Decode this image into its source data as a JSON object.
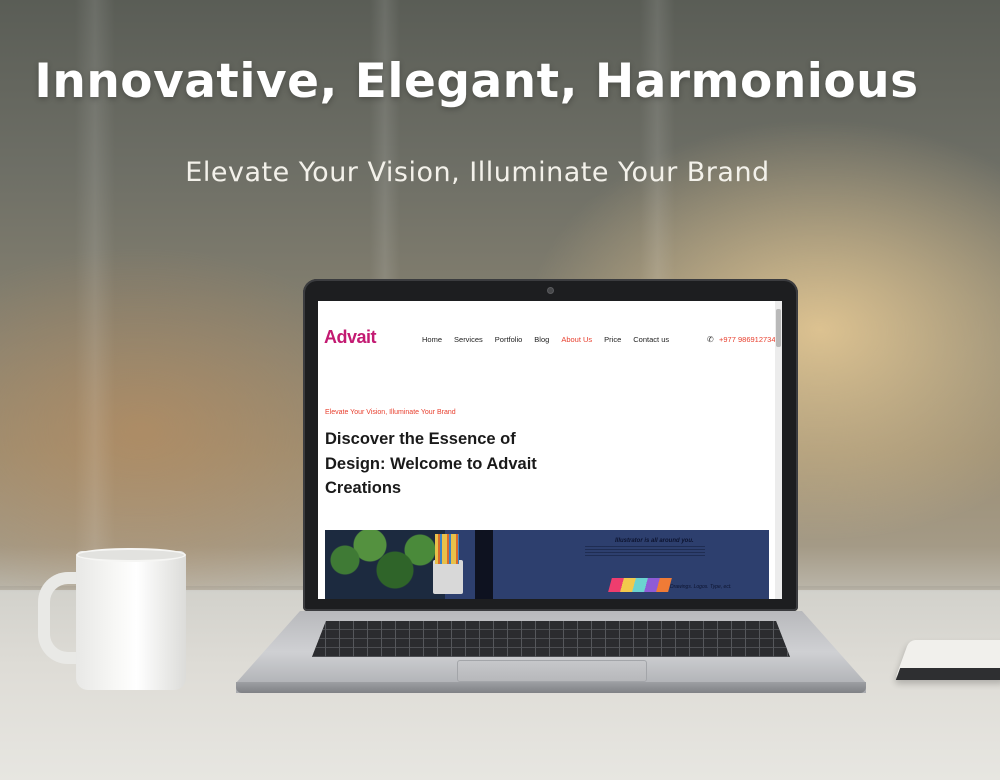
{
  "promo": {
    "headline": "Innovative, Elegant, Harmonious",
    "subheadline": "Elevate Your Vision, Illuminate Your Brand"
  },
  "website": {
    "logo": "Advait",
    "nav": [
      {
        "label": "Home",
        "active": false
      },
      {
        "label": "Services",
        "active": false
      },
      {
        "label": "Portfolio",
        "active": false
      },
      {
        "label": "Blog",
        "active": false
      },
      {
        "label": "About Us",
        "active": true
      },
      {
        "label": "Price",
        "active": false
      },
      {
        "label": "Contact us",
        "active": false
      }
    ],
    "phone_icon": "phone-icon",
    "phone": "+977 9869127349",
    "tagline": "Elevate Your Vision, Illuminate Your Brand",
    "hero_title": "Discover the Essence of Design: Welcome to Advait Creations",
    "banner": {
      "title": "Illustrator is all around you.",
      "subtitle": "Drawings. Logos. Type, ect."
    }
  },
  "colors": {
    "brand": "#c31a72",
    "accent": "#e8402f"
  }
}
